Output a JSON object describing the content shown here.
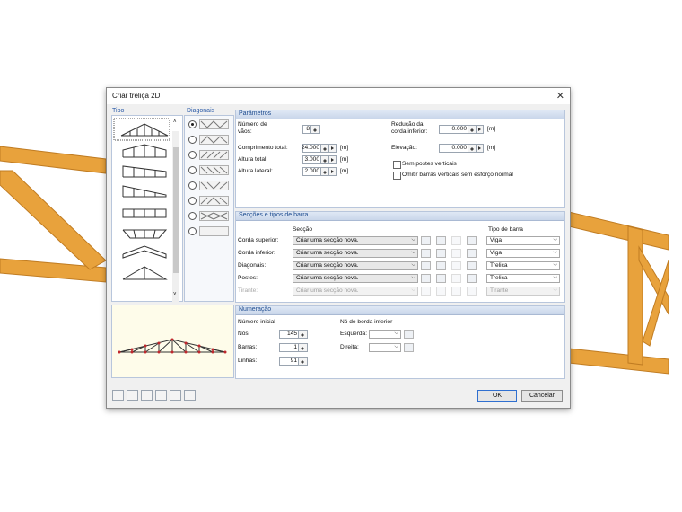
{
  "dialog": {
    "title": "Criar treliça 2D",
    "close_glyph": "✕"
  },
  "tipo": {
    "title": "Tipo",
    "item_count": 8
  },
  "diagonais": {
    "title": "Diagonais",
    "selected_index": 0
  },
  "parametros": {
    "title": "Parâmetros",
    "num_vaos_label": "Número de vãos:",
    "num_vaos_value": "8",
    "comprimento_label": "Comprimento total:",
    "comprimento_value": "24.000",
    "altura_total_label": "Altura total:",
    "altura_total_value": "3.000",
    "altura_lateral_label": "Altura lateral:",
    "altura_lateral_value": "2.000",
    "unit_m": "[m]",
    "reducao_label": "Redução da corda inferior:",
    "reducao_value": "0.000",
    "elevacao_label": "Elevação:",
    "elevacao_value": "0.000",
    "sem_postes_label": "Sem postes verticais",
    "omitir_label": "Omitir barras verticais sem esforço normal"
  },
  "seccoes": {
    "title": "Secções e tipos de barra",
    "col_seccao": "Secção",
    "col_tipo": "Tipo de barra",
    "rows": [
      {
        "label": "Corda superior:",
        "section": "Criar uma secção nova.",
        "type": "Viga",
        "enabled": true
      },
      {
        "label": "Corda inferior:",
        "section": "Criar uma secção nova.",
        "type": "Viga",
        "enabled": true
      },
      {
        "label": "Diagonais:",
        "section": "Criar uma secção nova.",
        "type": "Treliça",
        "enabled": true
      },
      {
        "label": "Postes:",
        "section": "Criar uma secção nova.",
        "type": "Treliça",
        "enabled": true
      },
      {
        "label": "Tirante:",
        "section": "Criar uma secção nova.",
        "type": "Tirante",
        "enabled": false
      }
    ]
  },
  "numeracao": {
    "title": "Numeração",
    "numero_inicial": "Número inicial",
    "nos_label": "Nós:",
    "nos_value": "145",
    "barras_label": "Barras:",
    "barras_value": "1",
    "linhas_label": "Linhas:",
    "linhas_value": "91",
    "no_borda": "Nó de borda inferior",
    "esquerda_label": "Esquerda:",
    "direita_label": "Direita:"
  },
  "buttons": {
    "ok": "OK",
    "cancel": "Cancelar"
  },
  "colors": {
    "accent": "#2a5aa8",
    "timber": "#e8a23c",
    "preview_node": "#c0282d"
  }
}
